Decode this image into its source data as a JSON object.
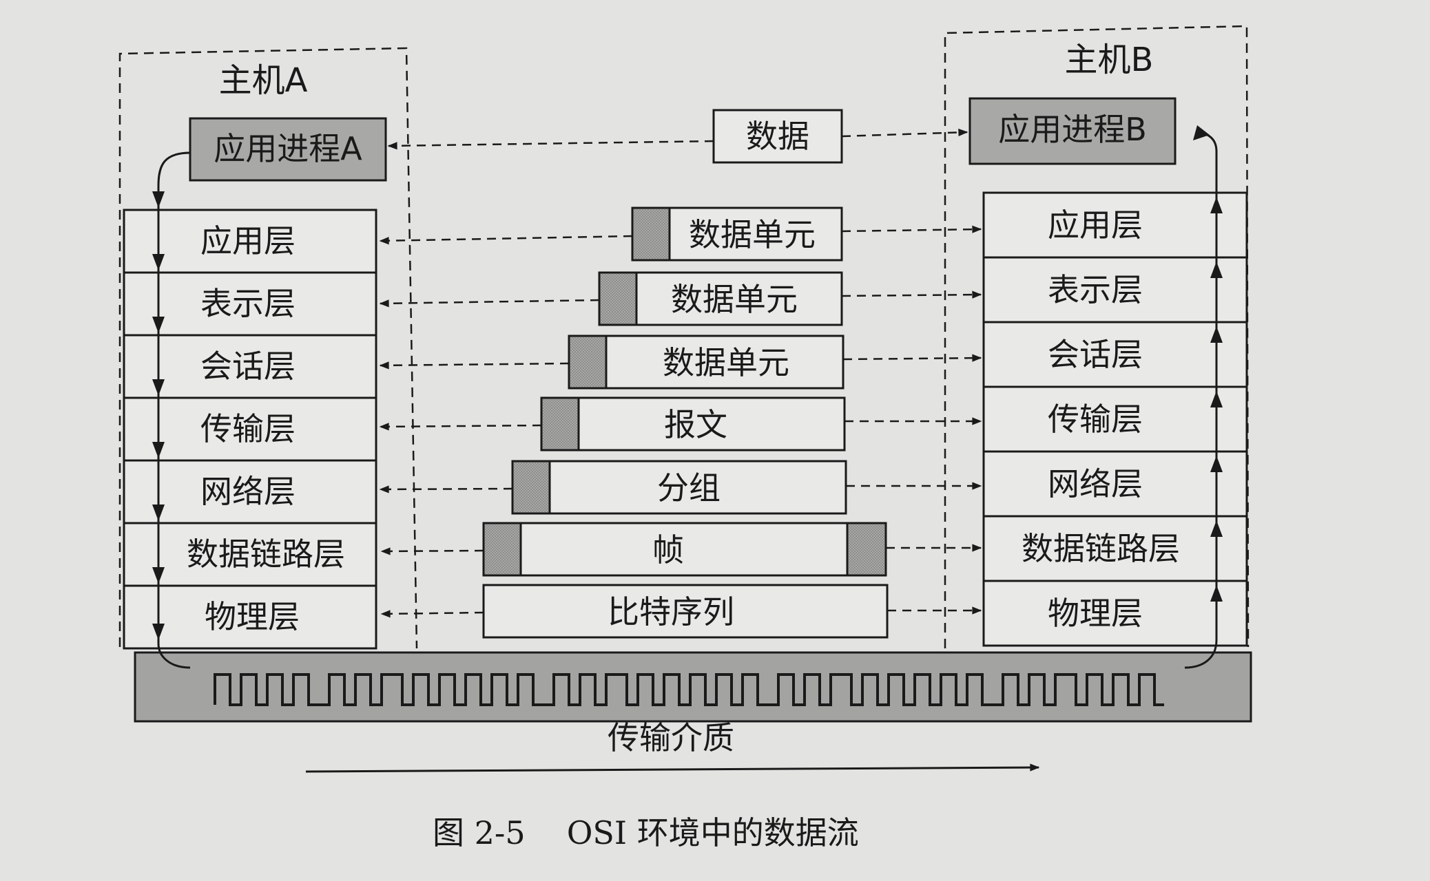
{
  "colors": {
    "paper": "#e3e3e1",
    "ink": "#1a1a1a",
    "box_fill": "#e9e9e7",
    "shaded_fill": "#a8a8a6",
    "medium_fill": "#a3a3a1"
  },
  "host_a": {
    "label": "主机A",
    "process": "应用进程A"
  },
  "host_b": {
    "label": "主机B",
    "process": "应用进程B"
  },
  "layers": [
    "应用层",
    "表示层",
    "会话层",
    "传输层",
    "网络层",
    "数据链路层",
    "物理层"
  ],
  "pdus": [
    "数据",
    "数据单元",
    "数据单元",
    "数据单元",
    "报文",
    "分组",
    "帧",
    "比特序列"
  ],
  "medium": {
    "label": "传输介质"
  },
  "caption": {
    "figure_number": "图 2-5",
    "title": "OSI 环境中的数据流"
  }
}
